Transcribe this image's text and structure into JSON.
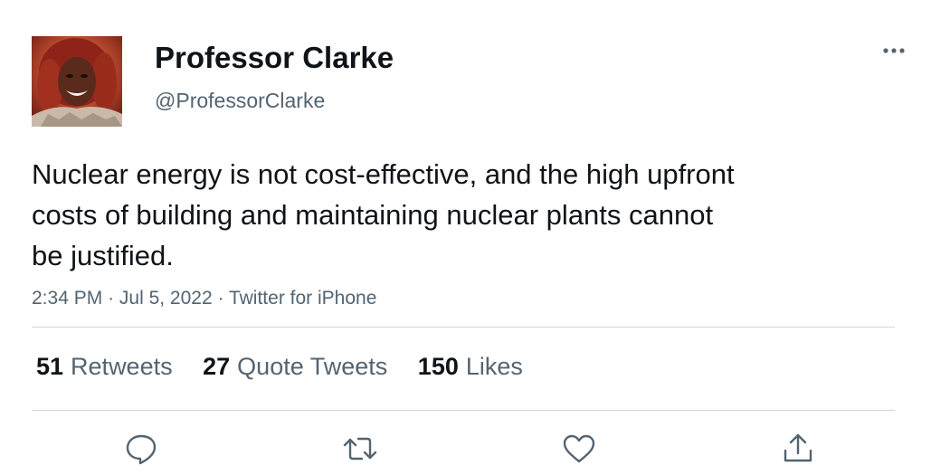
{
  "author": {
    "display_name": "Professor Clarke",
    "handle": "@ProfessorClarke",
    "avatar_icon": "profile-photo"
  },
  "more_icon": "ellipsis-icon",
  "tweet": {
    "text": "Nuclear energy is not cost-effective, and the high upfront costs of building and maintaining nuclear plants cannot be justified.",
    "time": "2:34 PM",
    "separator": "·",
    "date": "Jul 5, 2022",
    "source": "Twitter for iPhone"
  },
  "stats": {
    "retweets_count": "51",
    "retweets_label": "Retweets",
    "quotes_count": "27",
    "quotes_label": "Quote Tweets",
    "likes_count": "150",
    "likes_label": "Likes"
  },
  "actions": {
    "reply_icon": "speech-bubble-icon",
    "retweet_icon": "retweet-arrows-icon",
    "like_icon": "heart-icon",
    "share_icon": "share-upload-icon"
  },
  "colors": {
    "text_primary": "#0f1419",
    "text_secondary": "#536471",
    "divider": "#cfd9de"
  }
}
